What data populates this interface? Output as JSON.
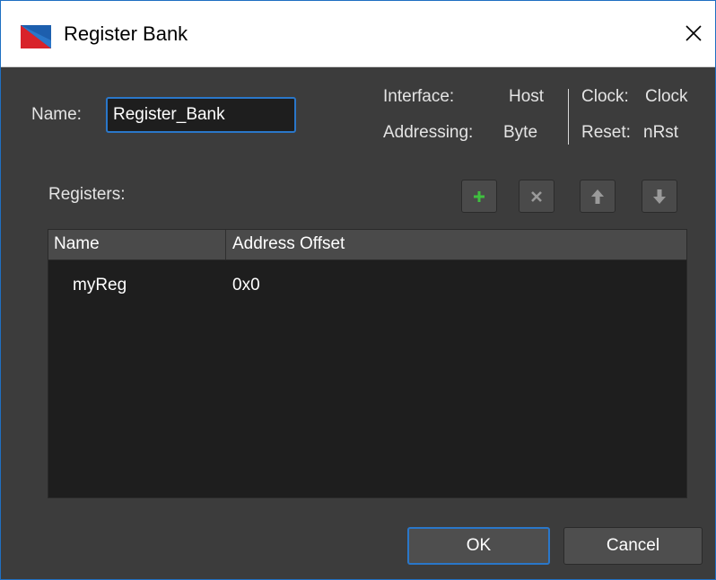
{
  "window": {
    "title": "Register Bank"
  },
  "name_field": {
    "label": "Name:",
    "value": "Register_Bank"
  },
  "info": {
    "interface_label": "Interface:",
    "interface_value": "Host",
    "addressing_label": "Addressing:",
    "addressing_value": "Byte",
    "clock_label": "Clock:",
    "clock_value": "Clock",
    "reset_label": "Reset:",
    "reset_value": "nRst"
  },
  "registers": {
    "label": "Registers:",
    "columns": [
      "Name",
      "Address Offset"
    ],
    "rows": [
      {
        "name": "myReg",
        "offset": "0x0"
      }
    ]
  },
  "toolbar": {
    "add_icon": "plus-icon",
    "remove_icon": "x-icon",
    "up_icon": "arrow-up-icon",
    "down_icon": "arrow-down-icon"
  },
  "buttons": {
    "ok": "OK",
    "cancel": "Cancel"
  },
  "colors": {
    "accent": "#2a77c9",
    "add_green": "#3fbf3f",
    "background": "#3c3c3c"
  }
}
